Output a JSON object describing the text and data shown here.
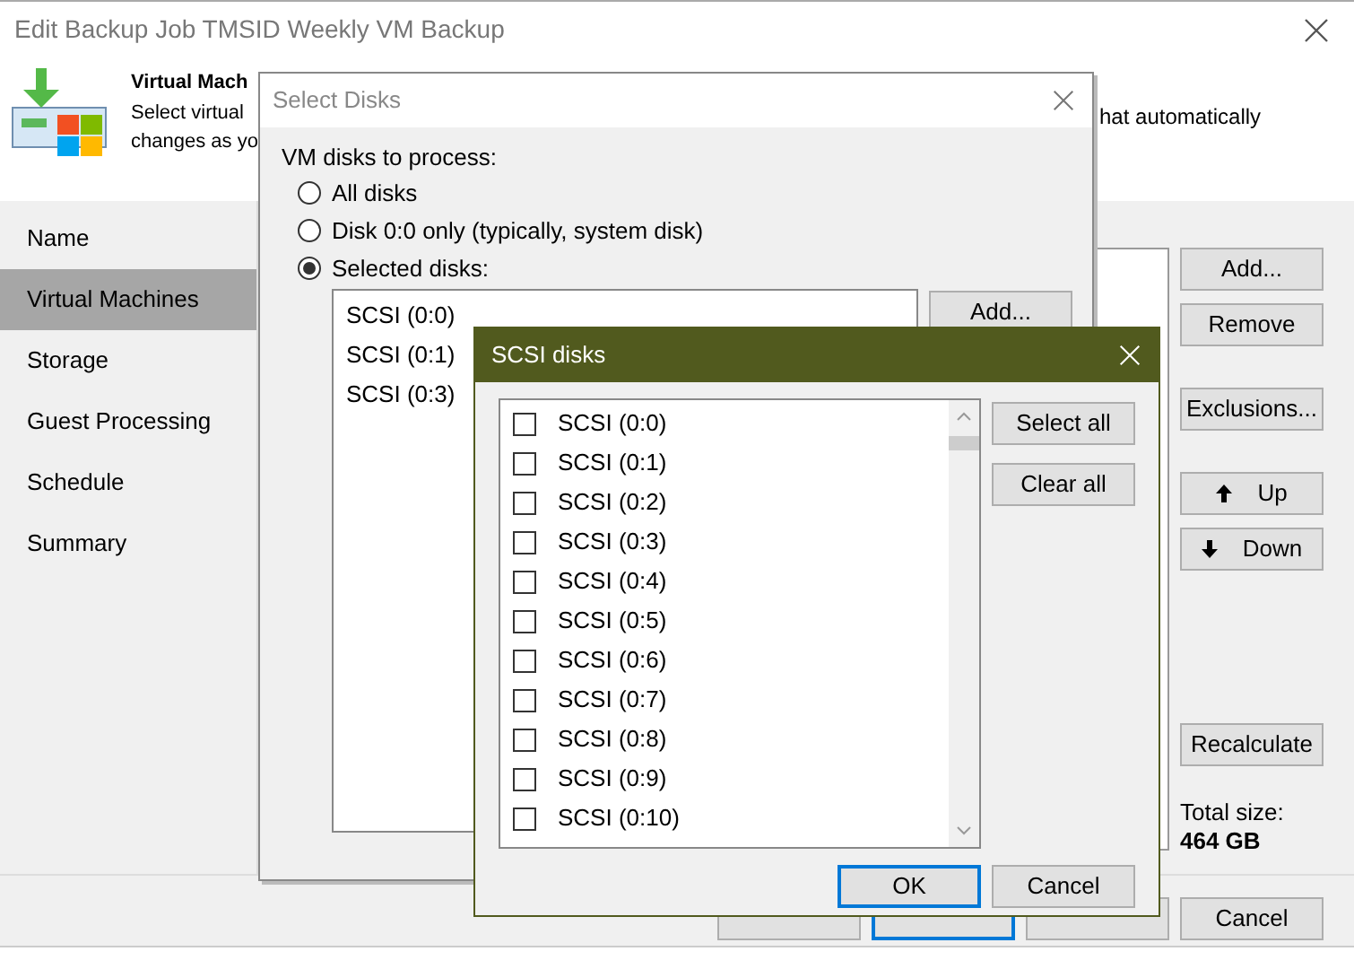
{
  "window": {
    "title": "Edit Backup Job TMSID Weekly VM Backup"
  },
  "header": {
    "title": "Virtual Mach",
    "description_lines": [
      "Select virtual",
      "changes as yo"
    ],
    "description_right": "hat automatically"
  },
  "sidebar": {
    "items": [
      {
        "label": "Name",
        "selected": false
      },
      {
        "label": "Virtual Machines",
        "selected": true
      },
      {
        "label": "Storage",
        "selected": false
      },
      {
        "label": "Guest Processing",
        "selected": false
      },
      {
        "label": "Schedule",
        "selected": false
      },
      {
        "label": "Summary",
        "selected": false
      }
    ]
  },
  "button_groups": [
    [
      {
        "label": "Add...",
        "kind": "plain"
      },
      {
        "label": "Remove",
        "kind": "plain"
      }
    ],
    [
      {
        "label": "Exclusions...",
        "kind": "plain"
      }
    ],
    [
      {
        "label": "Up",
        "kind": "up"
      },
      {
        "label": "Down",
        "kind": "down"
      }
    ],
    [
      {
        "label": "Recalculate",
        "kind": "plain"
      }
    ]
  ],
  "total_size": {
    "label": "Total size:",
    "value": "464 GB"
  },
  "wizard_buttons": [
    {
      "default": false
    },
    {
      "default": true
    },
    {
      "default": false
    },
    {
      "label": "Cancel",
      "default": false
    }
  ],
  "select_disks": {
    "title": "Select Disks",
    "prompt": "VM disks to process:",
    "options": [
      {
        "label": "All disks",
        "selected": false
      },
      {
        "label": "Disk 0:0 only (typically, system disk)",
        "selected": false
      },
      {
        "label": "Selected disks:",
        "selected": true
      }
    ],
    "disks": [
      "SCSI (0:0)",
      "SCSI (0:1)",
      "SCSI (0:3)"
    ],
    "add_button": "Add..."
  },
  "scsi_dialog": {
    "title": "SCSI disks",
    "disks": [
      {
        "label": "SCSI (0:0)",
        "checked": false
      },
      {
        "label": "SCSI (0:1)",
        "checked": false
      },
      {
        "label": "SCSI (0:2)",
        "checked": false
      },
      {
        "label": "SCSI (0:3)",
        "checked": false
      },
      {
        "label": "SCSI (0:4)",
        "checked": false
      },
      {
        "label": "SCSI (0:5)",
        "checked": false
      },
      {
        "label": "SCSI (0:6)",
        "checked": false
      },
      {
        "label": "SCSI (0:7)",
        "checked": false
      },
      {
        "label": "SCSI (0:8)",
        "checked": false
      },
      {
        "label": "SCSI (0:9)",
        "checked": false
      },
      {
        "label": "SCSI (0:10)",
        "checked": false
      }
    ],
    "select_all": "Select all",
    "clear_all": "Clear all",
    "buttons": [
      {
        "label": "OK",
        "default": true
      },
      {
        "label": "Cancel",
        "default": false
      }
    ]
  }
}
